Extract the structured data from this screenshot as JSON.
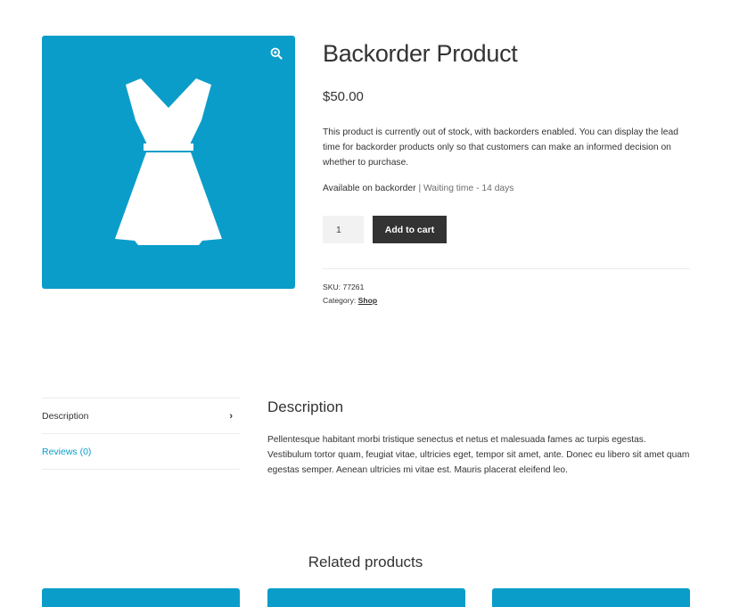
{
  "product": {
    "title": "Backorder Product",
    "price": "$50.00",
    "description": "This product is currently out of stock, with backorders enabled. You can display the lead time for backorder products only so that customers can make an informed decision on whether to purchase.",
    "availability": "Available on backorder",
    "waiting_time": " | Waiting time - 14 days",
    "quantity": "1",
    "add_to_cart_label": "Add to cart",
    "sku_label": "SKU: ",
    "sku": "77261",
    "category_label": "Category: ",
    "category": "Shop",
    "image_icon": "dress-icon",
    "zoom_icon": "magnify-plus-icon"
  },
  "tabs": [
    {
      "label": "Description",
      "active": true
    },
    {
      "label": "Reviews (0)",
      "active": false
    }
  ],
  "panel": {
    "title": "Description",
    "text": "Pellentesque habitant morbi tristique senectus et netus et malesuada fames ac turpis egestas. Vestibulum tortor quam, feugiat vitae, ultricies eget, tempor sit amet, ante. Donec eu libero sit amet quam egestas semper. Aenean ultricies mi vitae est. Mauris placerat eleifend leo."
  },
  "related": {
    "title": "Related products"
  },
  "colors": {
    "accent": "#0b9dc9",
    "button": "#333333",
    "text": "#333333"
  }
}
